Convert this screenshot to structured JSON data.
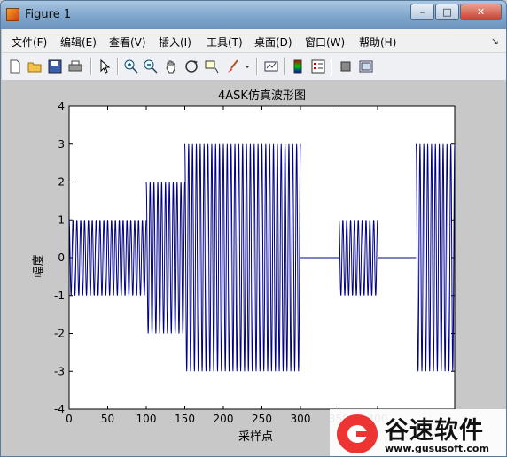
{
  "window": {
    "title": "Figure 1",
    "buttons": {
      "minimize": "–",
      "maximize": "□",
      "close": "✕"
    }
  },
  "menu": {
    "items": [
      "文件(F)",
      "编辑(E)",
      "查看(V)",
      "插入(I)",
      "工具(T)",
      "桌面(D)",
      "窗口(W)",
      "帮助(H)"
    ],
    "overflow": "↘"
  },
  "toolbar": {
    "icons": [
      "new-figure-icon",
      "open-file-icon",
      "save-icon",
      "print-icon",
      "pointer-icon",
      "zoom-in-icon",
      "zoom-out-icon",
      "pan-icon",
      "rotate-3d-icon",
      "data-cursor-icon",
      "brush-icon",
      "link-plot-icon",
      "colorbar-icon",
      "legend-icon",
      "hide-plot-tools-icon",
      "show-plot-tools-icon"
    ]
  },
  "chart_data": {
    "type": "line",
    "title": "4ASK仿真波形图",
    "xlabel": "采样点",
    "ylabel": "幅度",
    "xlim": [
      0,
      500
    ],
    "ylim": [
      -4,
      4
    ],
    "xticks": [
      0,
      50,
      100,
      150,
      200,
      250,
      300,
      350,
      400
    ],
    "yticks": [
      -4,
      -3,
      -2,
      -1,
      0,
      1,
      2,
      3,
      4
    ],
    "grid": false,
    "color": "#00008b",
    "segments": [
      {
        "x_start": 0,
        "x_end": 50,
        "amplitude": 1
      },
      {
        "x_start": 50,
        "x_end": 100,
        "amplitude": 1
      },
      {
        "x_start": 100,
        "x_end": 150,
        "amplitude": 2
      },
      {
        "x_start": 150,
        "x_end": 200,
        "amplitude": 3
      },
      {
        "x_start": 200,
        "x_end": 250,
        "amplitude": 3
      },
      {
        "x_start": 250,
        "x_end": 300,
        "amplitude": 3
      },
      {
        "x_start": 300,
        "x_end": 350,
        "amplitude": 0
      },
      {
        "x_start": 350,
        "x_end": 400,
        "amplitude": 1
      },
      {
        "x_start": 400,
        "x_end": 450,
        "amplitude": 0
      },
      {
        "x_start": 450,
        "x_end": 500,
        "amplitude": 3
      }
    ],
    "cycles_per_segment": 10
  },
  "watermark": {
    "name": "谷速软件",
    "url": "www.gususoft.com"
  }
}
